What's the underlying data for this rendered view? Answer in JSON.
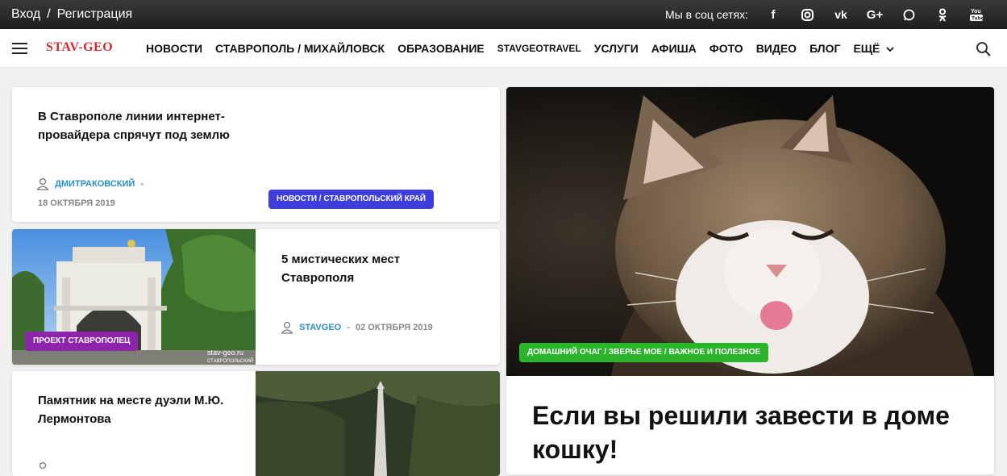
{
  "topbar": {
    "login": "Вход",
    "separator": "/",
    "register": "Регистрация",
    "social_label": "Мы в соц сетях:",
    "social_icons": [
      "facebook-icon",
      "instagram-icon",
      "vk-icon",
      "google-plus-icon",
      "whatsapp-icon",
      "odnoklassniki-icon",
      "youtube-icon"
    ]
  },
  "nav": {
    "logo": "STAV-GEO",
    "items": [
      "НОВОСТИ",
      "СТАВРОПОЛЬ / МИХАЙЛОВСК",
      "ОБРАЗОВАНИЕ",
      "STAVGEOTRAVEL",
      "УСЛУГИ",
      "АФИША",
      "ФОТО",
      "ВИДЕО",
      "БЛОГ",
      "ЕЩЁ"
    ]
  },
  "articles": [
    {
      "title": "В Ставрополе линии интернет-провайдера спрячут под землю",
      "author": "ДМИТРАКОВСКИЙ",
      "dash": "-",
      "date": "18 ОКТЯБРЯ 2019",
      "badge": "НОВОСТИ / СТАВРОПОЛЬСКИЙ КРАЙ"
    },
    {
      "title": "5 мистических мест Ставрополя",
      "author": "STAVGEO",
      "dash": "-",
      "date": "02 ОКТЯБРЯ 2019",
      "badge": "ПРОЕКТ СТАВРОПОЛЕЦ",
      "watermark": "stav-geo.ru",
      "watermark2": "СТАВРОПОЛЬСКИЙ"
    },
    {
      "title": "Памятник на месте дуэли М.Ю. Лермонтова"
    }
  ],
  "featured": {
    "badge": "ДОМАШНИЙ ОЧАГ / ЗВЕРЬЕ МОЕ / ВАЖНОЕ И ПОЛЕЗНОЕ",
    "title": "Если вы решили завести в доме кошку!"
  },
  "colors": {
    "badge_news": "#3d3ddb",
    "badge_project": "#8e24aa",
    "badge_home": "#2bb52b",
    "author_link": "#2a8fc6",
    "logo": "#d42a2a"
  }
}
